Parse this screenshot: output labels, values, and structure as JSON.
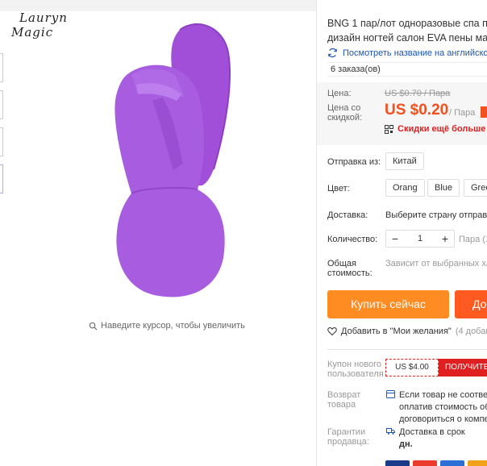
{
  "brand": {
    "logo_line1": "Lauryn",
    "logo_line2": "Magic"
  },
  "gallery": {
    "zoom_hint": "Наведите курсор, чтобы увеличить"
  },
  "product": {
    "title_line1": "BNG 1 пар/лот одноразовые спа п",
    "title_line2": "дизайн ногтей салон EVA пены ма",
    "translate_link": "Посмотреть название на английско",
    "orders": "6 заказа(ов)",
    "image_color": "#a85de0"
  },
  "price": {
    "label_price": "Цена:",
    "old": "US $0.70 / Пара",
    "label_discount_line1": "Цена со",
    "label_discount_line2": "скидкой:",
    "new": "US $0.20",
    "unit": "/ Пара",
    "more_discounts": "Скидки ещё больше в п",
    "accent_color": "#f1501f"
  },
  "options": {
    "ship_from_label": "Отправка из:",
    "ship_from_value": "Китай",
    "color_label": "Цвет:",
    "colors": [
      "Orang",
      "Blue",
      "Gree"
    ],
    "delivery_label": "Доставка:",
    "delivery_value": "Выберите страну отправки",
    "quantity_label": "Количество:",
    "quantity_minus": "−",
    "quantity_value": "1",
    "quantity_plus": "+",
    "quantity_unit": "Пара (1",
    "total_label_line1": "Общая",
    "total_label_line2": "стоимость:",
    "total_value": "Зависит от выбранных хар"
  },
  "actions": {
    "buy_now": "Купить сейчас",
    "add_to_cart": "До",
    "wishlist": "Добавить в \"Мои желания\"",
    "wishlist_count": "(4 добав"
  },
  "coupon": {
    "label_line1": "Купон нового",
    "label_line2": "пользователя",
    "amount": "US $4.00",
    "get": "ПОЛУЧИТЕ"
  },
  "returns": {
    "label_line1": "Возврат",
    "label_line2": "товара",
    "line1": "Если товар не соответс",
    "line2": "оплатив стоимость обр",
    "line3": "договориться о компен"
  },
  "guarantee": {
    "label_line1": "Гарантии",
    "label_line2": "продавца:",
    "line1": "Доставка в срок",
    "line2": "дн."
  },
  "payments": [
    "visa",
    "mastercard",
    "maestro",
    "other"
  ]
}
